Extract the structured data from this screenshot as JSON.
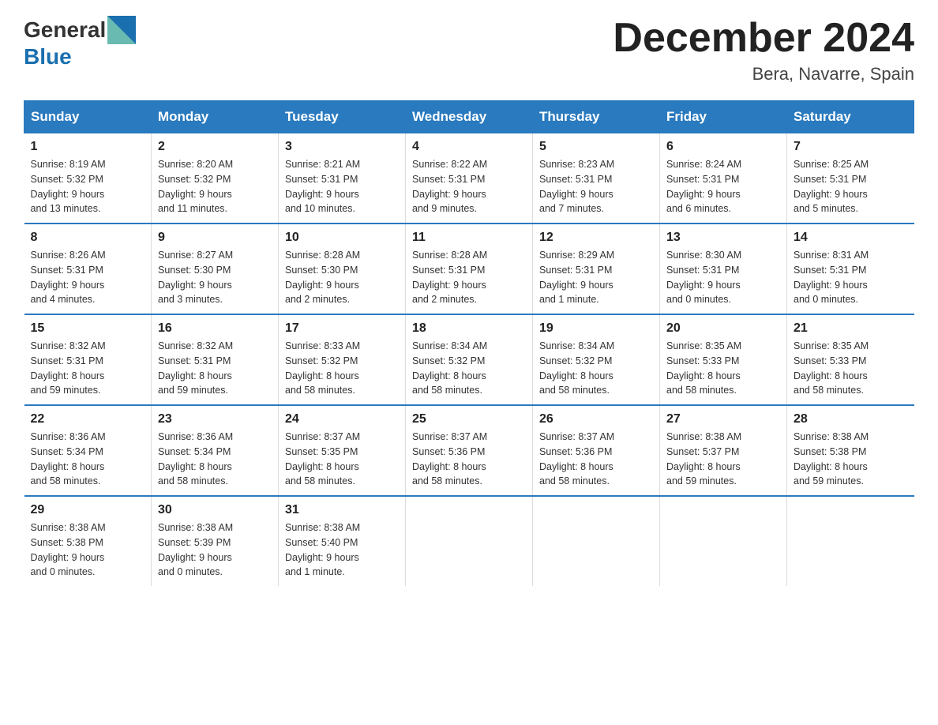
{
  "logo": {
    "text_general": "General",
    "text_blue": "Blue"
  },
  "title": {
    "month": "December 2024",
    "location": "Bera, Navarre, Spain"
  },
  "header_days": [
    "Sunday",
    "Monday",
    "Tuesday",
    "Wednesday",
    "Thursday",
    "Friday",
    "Saturday"
  ],
  "weeks": [
    [
      {
        "day": "1",
        "info": "Sunrise: 8:19 AM\nSunset: 5:32 PM\nDaylight: 9 hours\nand 13 minutes."
      },
      {
        "day": "2",
        "info": "Sunrise: 8:20 AM\nSunset: 5:32 PM\nDaylight: 9 hours\nand 11 minutes."
      },
      {
        "day": "3",
        "info": "Sunrise: 8:21 AM\nSunset: 5:31 PM\nDaylight: 9 hours\nand 10 minutes."
      },
      {
        "day": "4",
        "info": "Sunrise: 8:22 AM\nSunset: 5:31 PM\nDaylight: 9 hours\nand 9 minutes."
      },
      {
        "day": "5",
        "info": "Sunrise: 8:23 AM\nSunset: 5:31 PM\nDaylight: 9 hours\nand 7 minutes."
      },
      {
        "day": "6",
        "info": "Sunrise: 8:24 AM\nSunset: 5:31 PM\nDaylight: 9 hours\nand 6 minutes."
      },
      {
        "day": "7",
        "info": "Sunrise: 8:25 AM\nSunset: 5:31 PM\nDaylight: 9 hours\nand 5 minutes."
      }
    ],
    [
      {
        "day": "8",
        "info": "Sunrise: 8:26 AM\nSunset: 5:31 PM\nDaylight: 9 hours\nand 4 minutes."
      },
      {
        "day": "9",
        "info": "Sunrise: 8:27 AM\nSunset: 5:30 PM\nDaylight: 9 hours\nand 3 minutes."
      },
      {
        "day": "10",
        "info": "Sunrise: 8:28 AM\nSunset: 5:30 PM\nDaylight: 9 hours\nand 2 minutes."
      },
      {
        "day": "11",
        "info": "Sunrise: 8:28 AM\nSunset: 5:31 PM\nDaylight: 9 hours\nand 2 minutes."
      },
      {
        "day": "12",
        "info": "Sunrise: 8:29 AM\nSunset: 5:31 PM\nDaylight: 9 hours\nand 1 minute."
      },
      {
        "day": "13",
        "info": "Sunrise: 8:30 AM\nSunset: 5:31 PM\nDaylight: 9 hours\nand 0 minutes."
      },
      {
        "day": "14",
        "info": "Sunrise: 8:31 AM\nSunset: 5:31 PM\nDaylight: 9 hours\nand 0 minutes."
      }
    ],
    [
      {
        "day": "15",
        "info": "Sunrise: 8:32 AM\nSunset: 5:31 PM\nDaylight: 8 hours\nand 59 minutes."
      },
      {
        "day": "16",
        "info": "Sunrise: 8:32 AM\nSunset: 5:31 PM\nDaylight: 8 hours\nand 59 minutes."
      },
      {
        "day": "17",
        "info": "Sunrise: 8:33 AM\nSunset: 5:32 PM\nDaylight: 8 hours\nand 58 minutes."
      },
      {
        "day": "18",
        "info": "Sunrise: 8:34 AM\nSunset: 5:32 PM\nDaylight: 8 hours\nand 58 minutes."
      },
      {
        "day": "19",
        "info": "Sunrise: 8:34 AM\nSunset: 5:32 PM\nDaylight: 8 hours\nand 58 minutes."
      },
      {
        "day": "20",
        "info": "Sunrise: 8:35 AM\nSunset: 5:33 PM\nDaylight: 8 hours\nand 58 minutes."
      },
      {
        "day": "21",
        "info": "Sunrise: 8:35 AM\nSunset: 5:33 PM\nDaylight: 8 hours\nand 58 minutes."
      }
    ],
    [
      {
        "day": "22",
        "info": "Sunrise: 8:36 AM\nSunset: 5:34 PM\nDaylight: 8 hours\nand 58 minutes."
      },
      {
        "day": "23",
        "info": "Sunrise: 8:36 AM\nSunset: 5:34 PM\nDaylight: 8 hours\nand 58 minutes."
      },
      {
        "day": "24",
        "info": "Sunrise: 8:37 AM\nSunset: 5:35 PM\nDaylight: 8 hours\nand 58 minutes."
      },
      {
        "day": "25",
        "info": "Sunrise: 8:37 AM\nSunset: 5:36 PM\nDaylight: 8 hours\nand 58 minutes."
      },
      {
        "day": "26",
        "info": "Sunrise: 8:37 AM\nSunset: 5:36 PM\nDaylight: 8 hours\nand 58 minutes."
      },
      {
        "day": "27",
        "info": "Sunrise: 8:38 AM\nSunset: 5:37 PM\nDaylight: 8 hours\nand 59 minutes."
      },
      {
        "day": "28",
        "info": "Sunrise: 8:38 AM\nSunset: 5:38 PM\nDaylight: 8 hours\nand 59 minutes."
      }
    ],
    [
      {
        "day": "29",
        "info": "Sunrise: 8:38 AM\nSunset: 5:38 PM\nDaylight: 9 hours\nand 0 minutes."
      },
      {
        "day": "30",
        "info": "Sunrise: 8:38 AM\nSunset: 5:39 PM\nDaylight: 9 hours\nand 0 minutes."
      },
      {
        "day": "31",
        "info": "Sunrise: 8:38 AM\nSunset: 5:40 PM\nDaylight: 9 hours\nand 1 minute."
      },
      {
        "day": "",
        "info": ""
      },
      {
        "day": "",
        "info": ""
      },
      {
        "day": "",
        "info": ""
      },
      {
        "day": "",
        "info": ""
      }
    ]
  ]
}
